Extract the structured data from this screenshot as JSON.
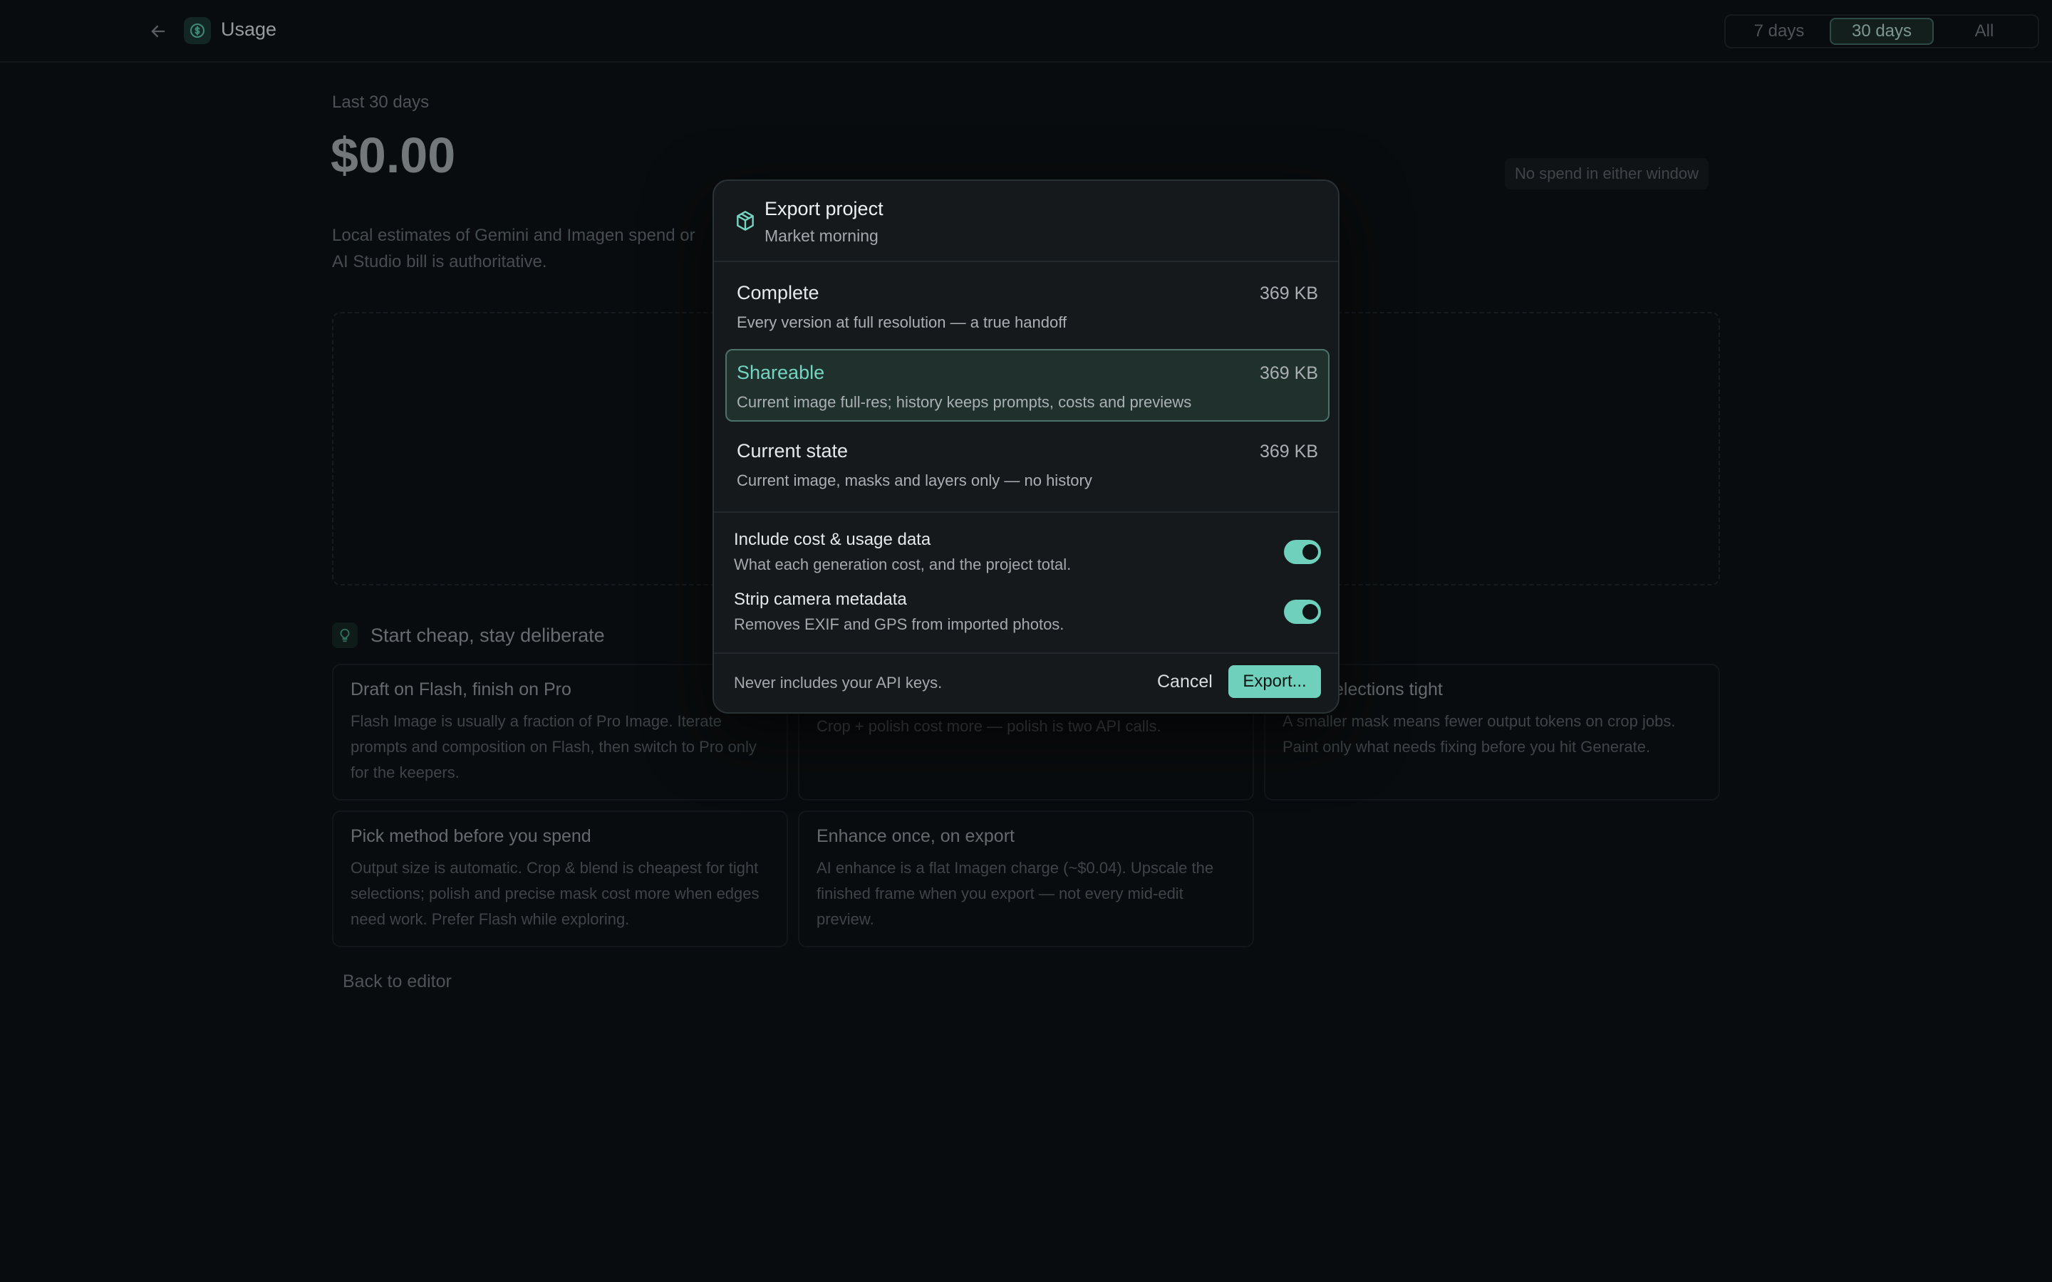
{
  "topbar": {
    "title": "Usage",
    "ranges": [
      {
        "label": "7 days",
        "active": false
      },
      {
        "label": "30 days",
        "active": true
      },
      {
        "label": "All",
        "active": false
      }
    ]
  },
  "summary": {
    "period_label": "Last 30 days",
    "amount": "$0.00",
    "no_spend_badge": "No spend in either window",
    "description_line1": "Local estimates of Gemini and Imagen spend or",
    "description_line2": "AI Studio bill is authoritative."
  },
  "tips": {
    "title": "Start cheap, stay deliberate",
    "items": [
      {
        "title": "Draft on Flash, finish on Pro",
        "body": "Flash Image is usually a fraction of Pro Image. Iterate prompts and composition on Flash, then switch to Pro only for the keepers."
      },
      {
        "title": "",
        "body": "Crop & blend only regenerates the selection. Full-frame and Crop + polish cost more — polish is two API calls."
      },
      {
        "title": "elections tight",
        "body": "A smaller mask means fewer output tokens on crop jobs. Paint only what needs fixing before you hit Generate."
      },
      {
        "title": "Pick method before you spend",
        "body": "Output size is automatic. Crop & blend is cheapest for tight selections; polish and precise mask cost more when edges need work. Prefer Flash while exploring."
      },
      {
        "title": "Enhance once, on export",
        "body": "AI enhance is a flat Imagen charge (~$0.04). Upscale the finished frame when you export — not every mid-edit preview."
      }
    ]
  },
  "back_link": "Back to editor",
  "modal": {
    "title": "Export project",
    "subtitle": "Market morning",
    "options": [
      {
        "name": "Complete",
        "size": "369 KB",
        "desc": "Every version at full resolution — a true handoff",
        "selected": false
      },
      {
        "name": "Shareable",
        "size": "369 KB",
        "desc": "Current image full-res; history keeps prompts, costs and previews",
        "selected": true
      },
      {
        "name": "Current state",
        "size": "369 KB",
        "desc": "Current image, masks and layers only — no history",
        "selected": false
      }
    ],
    "toggles": [
      {
        "label": "Include cost & usage data",
        "help": "What each generation cost, and the project total.",
        "on": true
      },
      {
        "label": "Strip camera metadata",
        "help": "Removes EXIF and GPS from imported photos.",
        "on": true
      }
    ],
    "footer_note": "Never includes your API keys.",
    "cancel_label": "Cancel",
    "export_label": "Export..."
  },
  "colors": {
    "accent": "#6fd0bb",
    "background": "#0b0f12",
    "modal_bg": "#15191c"
  }
}
